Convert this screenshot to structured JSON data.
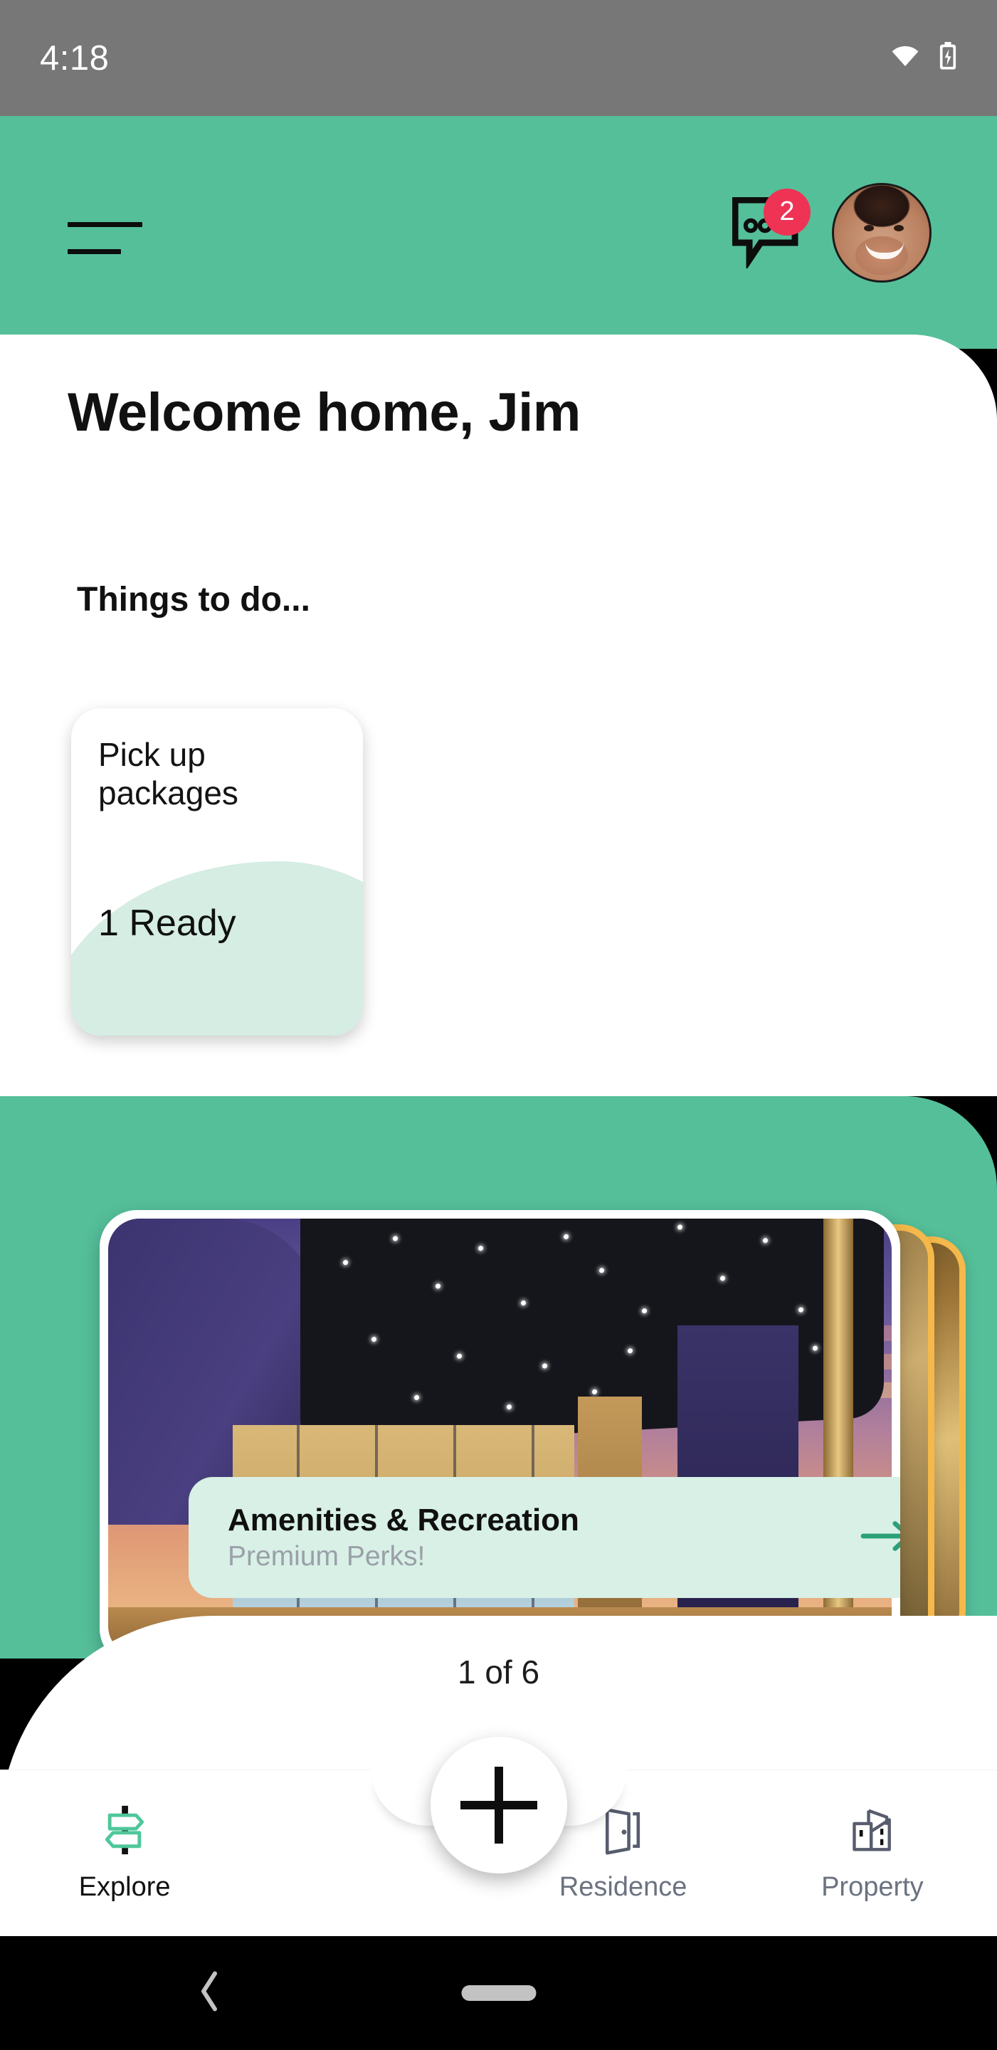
{
  "status_bar": {
    "time": "4:18",
    "wifi_icon": "wifi-icon",
    "battery_icon": "battery-charging-icon",
    "background": "#777777"
  },
  "app_bar": {
    "menu_icon": "hamburger-menu-icon",
    "chat_icon": "chat-bubble-icon",
    "chat_badge_count": "2",
    "badge_color": "#ee3355",
    "avatar_icon": "user-avatar",
    "background": "#55bf9a"
  },
  "main": {
    "welcome_title": "Welcome home, Jim",
    "things_heading": "Things to do...",
    "task_card": {
      "title": "Pick up packages",
      "status": "1 Ready",
      "blob_color": "#d5ede3"
    }
  },
  "carousel": {
    "card": {
      "title": "Amenities & Recreation",
      "subtitle": "Premium Perks!",
      "arrow_icon": "arrow-right-icon",
      "arrow_color": "#2aa179",
      "info_background": "#d8f0e6",
      "image_alt": "modern-building-at-dusk"
    },
    "stacked_card_border": "#f4b94a",
    "pagination": "1 of 6",
    "current": 1,
    "total": 6
  },
  "bottom_nav": {
    "fab_icon": "plus-icon",
    "items": [
      {
        "label": "Explore",
        "icon": "signpost-icon",
        "active": true
      },
      {
        "label": "Residence",
        "icon": "open-door-icon",
        "active": false
      },
      {
        "label": "Property",
        "icon": "buildings-icon",
        "active": false
      }
    ]
  },
  "android_nav": {
    "back_icon": "chevron-left-icon",
    "home_icon": "home-pill-indicator"
  },
  "colors": {
    "brand_green": "#55bf9a",
    "mint": "#d5ede3",
    "accent_red": "#ee3355",
    "gold": "#f4b94a"
  }
}
